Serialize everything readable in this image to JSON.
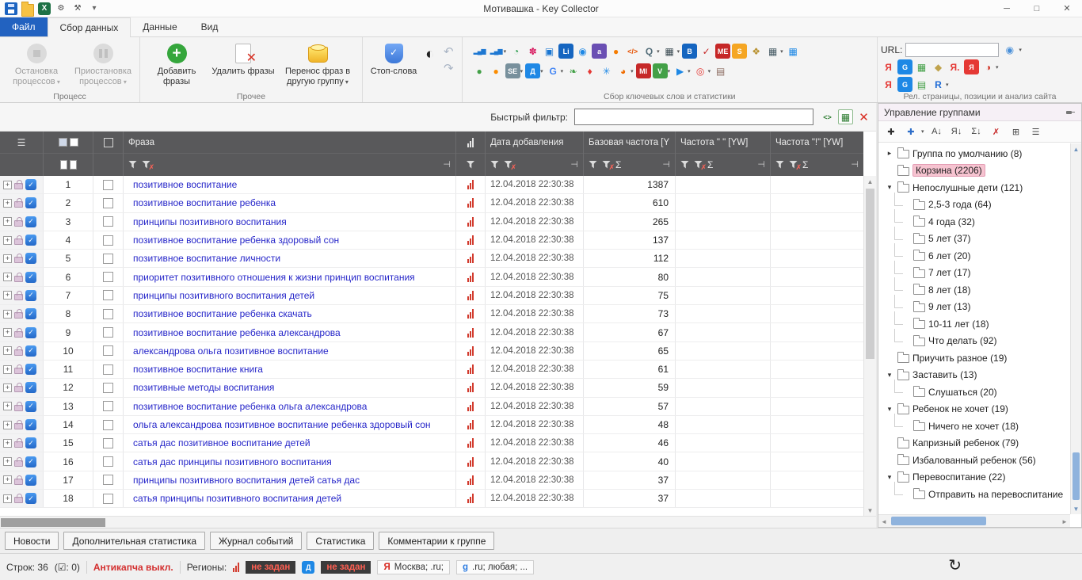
{
  "window": {
    "title": "Мотивашка - Key Collector",
    "minimize": "─",
    "maximize": "□",
    "close": "✕"
  },
  "quick_access": [
    {
      "name": "save-icon",
      "cls": "i-disk"
    },
    {
      "name": "open-folder-icon",
      "cls": "i-folder"
    },
    {
      "name": "excel-export-icon",
      "g": "X",
      "b": "#1e7145",
      "c": "#fff"
    },
    {
      "name": "settings-gear-icon",
      "g": "⚙",
      "c": "#444"
    },
    {
      "name": "tools-icon",
      "g": "⚒",
      "c": "#444"
    },
    {
      "name": "quick-access-dropdown-icon",
      "g": "▾",
      "c": "#666"
    }
  ],
  "tabs": [
    {
      "label": "Файл",
      "style": "file"
    },
    {
      "label": "Сбор данных",
      "active": true
    },
    {
      "label": "Данные"
    },
    {
      "label": "Вид"
    }
  ],
  "ribbon": {
    "groups": {
      "process": "Процесс",
      "other": "Прочее",
      "collect": "Сбор ключевых слов и статистики",
      "rel": "Рел. страницы, позиции и анализ сайта"
    },
    "buttons": {
      "stop": "Остановка процессов",
      "pause": "Приостановка процессов",
      "add": "Добавить фразы",
      "delete": "Удалить фразы",
      "move": "Перенос фраз в другую группу",
      "stopwords": "Стоп-слова"
    },
    "url_label": "URL:",
    "collect_icons_row1": [
      {
        "name": "yandex-wordstat-icon",
        "g": "▂▄▆",
        "c": "#1e78d2",
        "cls": "bars"
      },
      {
        "name": "wordstat-deep-icon",
        "g": "▂▄▆",
        "c": "#1e78d2",
        "cls": "bars",
        "dd": true
      },
      {
        "name": "analytics-pie-icon",
        "g": "◔",
        "c": "#2e9e4f"
      },
      {
        "name": "flower-icon",
        "g": "✽",
        "c": "#d81b60"
      },
      {
        "name": "photos-icon",
        "g": "▣",
        "c": "#1976d2"
      },
      {
        "name": "liveinternet-icon",
        "g": "Li",
        "b": "#1565c0",
        "c": "#fff"
      },
      {
        "name": "globe-stats-icon",
        "g": "◉",
        "c": "#1e88e5"
      },
      {
        "name": "alexa-icon",
        "g": "a",
        "b": "#6a4fb3",
        "c": "#fff"
      },
      {
        "name": "orange-ball-icon",
        "g": "●",
        "c": "#f57c00"
      },
      {
        "name": "code-icon",
        "g": "</>",
        "c": "#e65100",
        "cls": "code"
      },
      {
        "name": "search-lookup-icon",
        "g": "Q",
        "c": "#546e7a",
        "dd": true
      },
      {
        "name": "snapshot-icon",
        "g": "▦",
        "c": "#37474f",
        "dd": true
      },
      {
        "name": "bing-icon",
        "g": "B",
        "b": "#1565c0",
        "c": "#fff"
      },
      {
        "name": "check-positions-icon",
        "g": "✓",
        "c": "#c62828"
      },
      {
        "name": "megaindex-icon",
        "g": "МЕ",
        "b": "#c62828",
        "c": "#fff"
      },
      {
        "name": "spywords-icon",
        "g": "S",
        "b": "#f5a623",
        "c": "#fff"
      },
      {
        "name": "keys-so-icon",
        "g": "❖",
        "c": "#b8912f"
      },
      {
        "name": "export-table-icon",
        "g": "▦",
        "c": "#455a64",
        "dd": true
      },
      {
        "name": "import-table-icon",
        "g": "▦",
        "c": "#1e88e5"
      }
    ],
    "collect_icons_row2": [
      {
        "name": "metrika-icon",
        "g": "●",
        "c": "#43a047"
      },
      {
        "name": "sape-icon",
        "g": "●",
        "c": "#fb8c00"
      },
      {
        "name": "serp-parser-icon",
        "g": "SE",
        "b": "#78909c",
        "c": "#fff",
        "dd": true
      },
      {
        "name": "yandex-direct-icon",
        "g": "Д",
        "b": "#1e88e5",
        "c": "#fff",
        "dd": true
      },
      {
        "name": "google-ads-icon",
        "g": "G",
        "c": "#4285f4",
        "dd": true
      },
      {
        "name": "leaf-icon",
        "g": "❧",
        "c": "#43a047"
      },
      {
        "name": "pepper-icon",
        "g": "♦",
        "c": "#e53935"
      },
      {
        "name": "snowflake-icon",
        "g": "✳",
        "c": "#1e88e5"
      },
      {
        "name": "firefox-icon",
        "g": "◕",
        "c": "#ef6c00",
        "dd": true
      },
      {
        "name": "megaindex-premium-icon",
        "g": "MI",
        "b": "#c62828",
        "c": "#fff"
      },
      {
        "name": "seranking-icon",
        "g": "V",
        "b": "#43a047",
        "c": "#fff",
        "dd": true
      },
      {
        "name": "send-icon",
        "g": "▶",
        "c": "#1e88e5",
        "dd": true
      },
      {
        "name": "target-icon",
        "g": "◎",
        "c": "#e53935",
        "dd": true
      },
      {
        "name": "bricks-icon",
        "g": "▤",
        "c": "#8d6e63"
      }
    ],
    "rel_icons_row1": [
      {
        "name": "yandex-rel-icon",
        "g": "Я",
        "c": "#e53935"
      },
      {
        "name": "google-rel-icon",
        "g": "G",
        "b": "#1e88e5",
        "c": "#fff"
      },
      {
        "name": "green-pages-icon",
        "g": "▦",
        "c": "#43a047"
      },
      {
        "name": "tag-icon",
        "g": "◆",
        "c": "#c0a34d"
      },
      {
        "name": "yandex-dot-icon",
        "g": "Я.",
        "c": "#e53935"
      },
      {
        "name": "yandex-box-icon",
        "g": "Я",
        "b": "#e53935",
        "c": "#fff"
      },
      {
        "name": "stats-pie-icon",
        "g": "◑",
        "c": "#d23b2e",
        "dd": true
      }
    ],
    "rel_icons_row2": [
      {
        "name": "yandex-pos-icon",
        "g": "Я",
        "c": "#e53935"
      },
      {
        "name": "google-pos-icon",
        "g": "G",
        "b": "#1e88e5",
        "c": "#fff"
      },
      {
        "name": "site-analysis-icon",
        "g": "▤",
        "c": "#43a047"
      },
      {
        "name": "r-service-icon",
        "g": "R",
        "c": "#1e6bd6",
        "dd": true
      }
    ]
  },
  "filter": {
    "label": "Быстрый фильтр:",
    "value": "",
    "icons": [
      {
        "name": "regex-filter-icon",
        "g": "<>",
        "c": "#2e7d32",
        "cls": "code"
      },
      {
        "name": "filter-table-icon",
        "g": "▦",
        "c": "#2e7d32",
        "cls": "outlined"
      },
      {
        "name": "clear-filter-icon",
        "g": "✕",
        "c": "#d93025",
        "cls": "big-x"
      }
    ]
  },
  "table": {
    "columns": {
      "phrase": "Фраза",
      "date": "Дата добавления",
      "base_freq": "Базовая частота [Y",
      "freq_quotes": "Частота \" \" [YW]",
      "freq_excl": "Частота \"!\" [YW]"
    },
    "rows": [
      {
        "num": 1,
        "phrase": "позитивное воспитание",
        "date": "12.04.2018 22:30:38",
        "base_freq": 1387
      },
      {
        "num": 2,
        "phrase": "позитивное воспитание ребенка",
        "date": "12.04.2018 22:30:38",
        "base_freq": 610
      },
      {
        "num": 3,
        "phrase": "принципы позитивного воспитания",
        "date": "12.04.2018 22:30:38",
        "base_freq": 265
      },
      {
        "num": 4,
        "phrase": "позитивное воспитание ребенка здоровый сон",
        "date": "12.04.2018 22:30:38",
        "base_freq": 137
      },
      {
        "num": 5,
        "phrase": "позитивное воспитание личности",
        "date": "12.04.2018 22:30:38",
        "base_freq": 112
      },
      {
        "num": 6,
        "phrase": "приоритет позитивного отношения к жизни принцип воспитания",
        "date": "12.04.2018 22:30:38",
        "base_freq": 80
      },
      {
        "num": 7,
        "phrase": "принципы позитивного воспитания детей",
        "date": "12.04.2018 22:30:38",
        "base_freq": 75
      },
      {
        "num": 8,
        "phrase": "позитивное воспитание ребенка скачать",
        "date": "12.04.2018 22:30:38",
        "base_freq": 73
      },
      {
        "num": 9,
        "phrase": "позитивное воспитание ребенка александрова",
        "date": "12.04.2018 22:30:38",
        "base_freq": 67
      },
      {
        "num": 10,
        "phrase": "александрова ольга позитивное воспитание",
        "date": "12.04.2018 22:30:38",
        "base_freq": 65
      },
      {
        "num": 11,
        "phrase": "позитивное воспитание книга",
        "date": "12.04.2018 22:30:38",
        "base_freq": 61
      },
      {
        "num": 12,
        "phrase": "позитивные методы воспитания",
        "date": "12.04.2018 22:30:38",
        "base_freq": 59
      },
      {
        "num": 13,
        "phrase": "позитивное воспитание ребенка ольга александрова",
        "date": "12.04.2018 22:30:38",
        "base_freq": 57
      },
      {
        "num": 14,
        "phrase": "ольга александрова позитивное воспитание ребенка здоровый сон",
        "date": "12.04.2018 22:30:38",
        "base_freq": 48
      },
      {
        "num": 15,
        "phrase": "сатья дас позитивное воспитание детей",
        "date": "12.04.2018 22:30:38",
        "base_freq": 46
      },
      {
        "num": 16,
        "phrase": "сатья дас принципы позитивного воспитания",
        "date": "12.04.2018 22:30:38",
        "base_freq": 40
      },
      {
        "num": 17,
        "phrase": "принципы позитивного воспитания детей сатья дас",
        "date": "12.04.2018 22:30:38",
        "base_freq": 37
      },
      {
        "num": 18,
        "phrase": "сатья принципы позитивного воспитания детей",
        "date": "12.04.2018 22:30:38",
        "base_freq": 37
      }
    ]
  },
  "groups_panel": {
    "title": "Управление группами",
    "toolbar": [
      {
        "name": "add-group-icon",
        "g": "✚",
        "c": "#2e2e2e"
      },
      {
        "name": "add-subgroup-icon",
        "g": "✚",
        "c": "#2e6ec9",
        "dd": true
      },
      {
        "name": "sort-az-icon",
        "g": "A↓",
        "c": "#444"
      },
      {
        "name": "sort-za-icon",
        "g": "Я↓",
        "c": "#444"
      },
      {
        "name": "sort-count-icon",
        "g": "Σ↓",
        "c": "#444"
      },
      {
        "name": "delete-group-icon",
        "g": "✗",
        "c": "#c62828"
      },
      {
        "name": "export-groups-icon",
        "g": "⊞",
        "c": "#444"
      },
      {
        "name": "tree-settings-icon",
        "g": "☰",
        "c": "#444"
      }
    ],
    "items": [
      {
        "text": "Группа по умолчанию (8)",
        "level": 0,
        "arrow": "right"
      },
      {
        "text": "Корзина (2206)",
        "level": 0,
        "selected": true
      },
      {
        "text": "Непослушные дети (121)",
        "level": 0,
        "arrow": "down"
      },
      {
        "text": "2,5-3 года (64)",
        "level": 1
      },
      {
        "text": "4 года (32)",
        "level": 1
      },
      {
        "text": "5 лет (37)",
        "level": 1
      },
      {
        "text": "6 лет (20)",
        "level": 1
      },
      {
        "text": "7 лет (17)",
        "level": 1
      },
      {
        "text": "8 лет (18)",
        "level": 1
      },
      {
        "text": "9 лет (13)",
        "level": 1
      },
      {
        "text": "10-11 лет (18)",
        "level": 1
      },
      {
        "text": "Что делать (92)",
        "level": 1
      },
      {
        "text": "Приучить разное (19)",
        "level": 0
      },
      {
        "text": "Заставить (13)",
        "level": 0,
        "arrow": "down"
      },
      {
        "text": "Слушаться (20)",
        "level": 1
      },
      {
        "text": "Ребенок не хочет (19)",
        "level": 0,
        "arrow": "down"
      },
      {
        "text": "Ничего не хочет (18)",
        "level": 1
      },
      {
        "text": "Капризный ребенок (79)",
        "level": 0
      },
      {
        "text": "Избалованный ребенок (56)",
        "level": 0
      },
      {
        "text": "Перевоспитание (22)",
        "level": 0,
        "arrow": "down"
      },
      {
        "text": "Отправить на перевоспитание",
        "level": 1
      }
    ]
  },
  "bottom_tabs": [
    "Новости",
    "Дополнительная статистика",
    "Журнал событий",
    "Статистика",
    "Комментарии к группе"
  ],
  "status": {
    "rows": "Строк: 36",
    "checked": "(☑: 0)",
    "anticaptcha": "Антикапча выкл.",
    "regions_label": "Регионы:",
    "region_wordstat": "не задан",
    "region_direct": "не задан",
    "region_yandex": "Москва; .ru;",
    "region_google": ".ru; любая; ..."
  }
}
